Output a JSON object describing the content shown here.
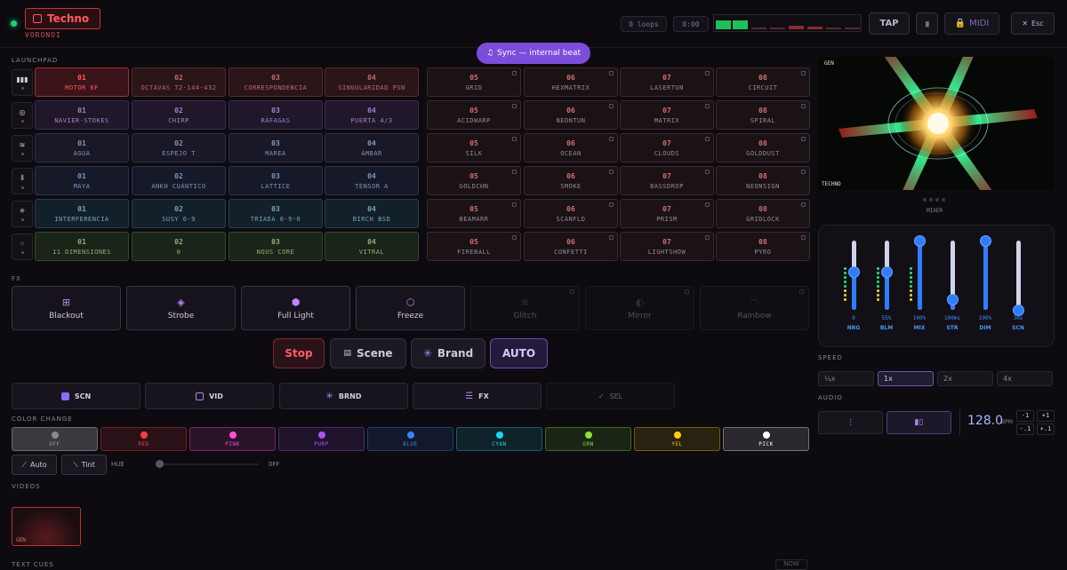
{
  "header": {
    "genre": "Techno",
    "visual_name": "VORONOI",
    "loops": "0 loops",
    "time": "0:00",
    "tap": "TAP",
    "midi": "MIDI",
    "esc": "Esc",
    "accent": "#ff4b55"
  },
  "sync_badge": "Sync — internal beat",
  "launchpad": {
    "label": "LAUNCHPAD",
    "rows": [
      {
        "icon": "bars-icon",
        "cells": [
          [
            "01",
            "MOTOR 6F"
          ],
          [
            "02",
            "OCTAVAS 72·144·432"
          ],
          [
            "03",
            "CORRESPONDENCIA"
          ],
          [
            "04",
            "SINGULARIDAD PSN"
          ],
          [
            "05",
            "GRID"
          ],
          [
            "06",
            "HEXMATRIX"
          ],
          [
            "07",
            "LASERTUN"
          ],
          [
            "08",
            "CIRCUIT"
          ]
        ]
      },
      {
        "icon": "spiral-icon",
        "cells": [
          [
            "01",
            "NAVIER-STOKES"
          ],
          [
            "02",
            "CHIRP"
          ],
          [
            "03",
            "RÁFAGAS"
          ],
          [
            "04",
            "PUERTA 4/3"
          ],
          [
            "05",
            "ACIDWARP"
          ],
          [
            "06",
            "NEONTUN"
          ],
          [
            "07",
            "MATRIX"
          ],
          [
            "08",
            "SPIRAL"
          ]
        ]
      },
      {
        "icon": "wave-icon",
        "cells": [
          [
            "01",
            "AGUA"
          ],
          [
            "02",
            "ESPEJO T"
          ],
          [
            "03",
            "MAREA"
          ],
          [
            "04",
            "ÁMBAR"
          ],
          [
            "05",
            "SILK"
          ],
          [
            "06",
            "OCEAN"
          ],
          [
            "07",
            "CLOUDS"
          ],
          [
            "08",
            "GOLDDUST"
          ]
        ]
      },
      {
        "icon": "waveform-icon",
        "cells": [
          [
            "01",
            "MAYA"
          ],
          [
            "02",
            "ANKH CUÁNTICO"
          ],
          [
            "03",
            "LATTICE"
          ],
          [
            "04",
            "TENSOR A"
          ],
          [
            "05",
            "GOLDCHN"
          ],
          [
            "06",
            "SMOKE"
          ],
          [
            "07",
            "BASSDROP"
          ],
          [
            "08",
            "NEONSIGN"
          ]
        ]
      },
      {
        "icon": "starburst-icon",
        "cells": [
          [
            "01",
            "INTERFERENCIA"
          ],
          [
            "02",
            "SUSY 0·9"
          ],
          [
            "03",
            "TRÍADA 0·9·0"
          ],
          [
            "04",
            "BIRCH BSD"
          ],
          [
            "05",
            "BEAMARR"
          ],
          [
            "06",
            "SCANFLD"
          ],
          [
            "07",
            "PRISM"
          ],
          [
            "08",
            "GRIDLOCK"
          ]
        ]
      },
      {
        "icon": "dots-icon",
        "cells": [
          [
            "01",
            "11 DIMENSIONES"
          ],
          [
            "02",
            "0"
          ],
          [
            "03",
            "NOUS CORE"
          ],
          [
            "04",
            "VITRAL"
          ],
          [
            "05",
            "FIREBALL"
          ],
          [
            "06",
            "CONFETTI"
          ],
          [
            "07",
            "LIGHTSHOW"
          ],
          [
            "08",
            "PYRO"
          ]
        ]
      }
    ]
  },
  "fx": {
    "label": "FX",
    "buttons": [
      {
        "label": "Blackout",
        "icon": "grid-icon",
        "disabled": false
      },
      {
        "label": "Strobe",
        "icon": "diamond-icon",
        "disabled": false
      },
      {
        "label": "Full Light",
        "icon": "hexagon-fill-icon",
        "disabled": false
      },
      {
        "label": "Freeze",
        "icon": "hexagon-icon",
        "disabled": false
      },
      {
        "label": "Glitch",
        "icon": "lines-icon",
        "disabled": true
      },
      {
        "label": "Mirror",
        "icon": "mirror-icon",
        "disabled": true
      },
      {
        "label": "Rainbow",
        "icon": "arc-icon",
        "disabled": true
      }
    ]
  },
  "controls": {
    "stop": "Stop",
    "scene": "Scene",
    "brand": "Brand",
    "auto": "AUTO"
  },
  "quick": {
    "scn": "SCN",
    "vid": "VID",
    "brnd": "BRND",
    "fx": "FX",
    "sel": "SEL"
  },
  "color_change": {
    "label": "COLOR CHANGE",
    "colors": [
      {
        "label": "OFF",
        "hex": "#8a8a8a"
      },
      {
        "label": "RED",
        "hex": "#ff3b4a"
      },
      {
        "label": "PINK",
        "hex": "#ff4fd8"
      },
      {
        "label": "PURP",
        "hex": "#a855f7"
      },
      {
        "label": "BLUE",
        "hex": "#3b82f6"
      },
      {
        "label": "CYAN",
        "hex": "#22d3ee"
      },
      {
        "label": "GRN",
        "hex": "#84e53a"
      },
      {
        "label": "YEL",
        "hex": "#facc15"
      },
      {
        "label": "PICK",
        "hex": "#ffffff"
      }
    ],
    "auto": "Auto",
    "tint": "Tint",
    "hue": "HUE",
    "hue_value": "OFF"
  },
  "videos": {
    "label": "VIDEOS",
    "thumb": "GEN"
  },
  "text_cues": {
    "label": "TEXT CUES",
    "now": "NOW"
  },
  "preview": {
    "tag": "GEN",
    "genre": "TECHNO",
    "mixer_label": "MIXER"
  },
  "mixer": {
    "faders": [
      {
        "label": "NRG",
        "value": "0",
        "level": 0.55
      },
      {
        "label": "BLM",
        "value": "55%",
        "level": 0.55
      },
      {
        "label": "MIX",
        "value": "100%",
        "level": 1.0
      },
      {
        "label": "STR",
        "value": "100ms",
        "level": 0.15
      },
      {
        "label": "DIM",
        "value": "100%",
        "level": 1.0
      },
      {
        "label": "SCN",
        "value": "30s",
        "level": 0.0
      }
    ]
  },
  "speed": {
    "label": "SPEED",
    "options": [
      "¼x",
      "1x",
      "2x",
      "4x"
    ],
    "selected": "1x"
  },
  "audio": {
    "label": "AUDIO",
    "bpm": "128.0",
    "bpm_unit": "BPM",
    "dec": "-1",
    "inc": "+1",
    "dec2": "-.1",
    "inc2": "+.1"
  }
}
